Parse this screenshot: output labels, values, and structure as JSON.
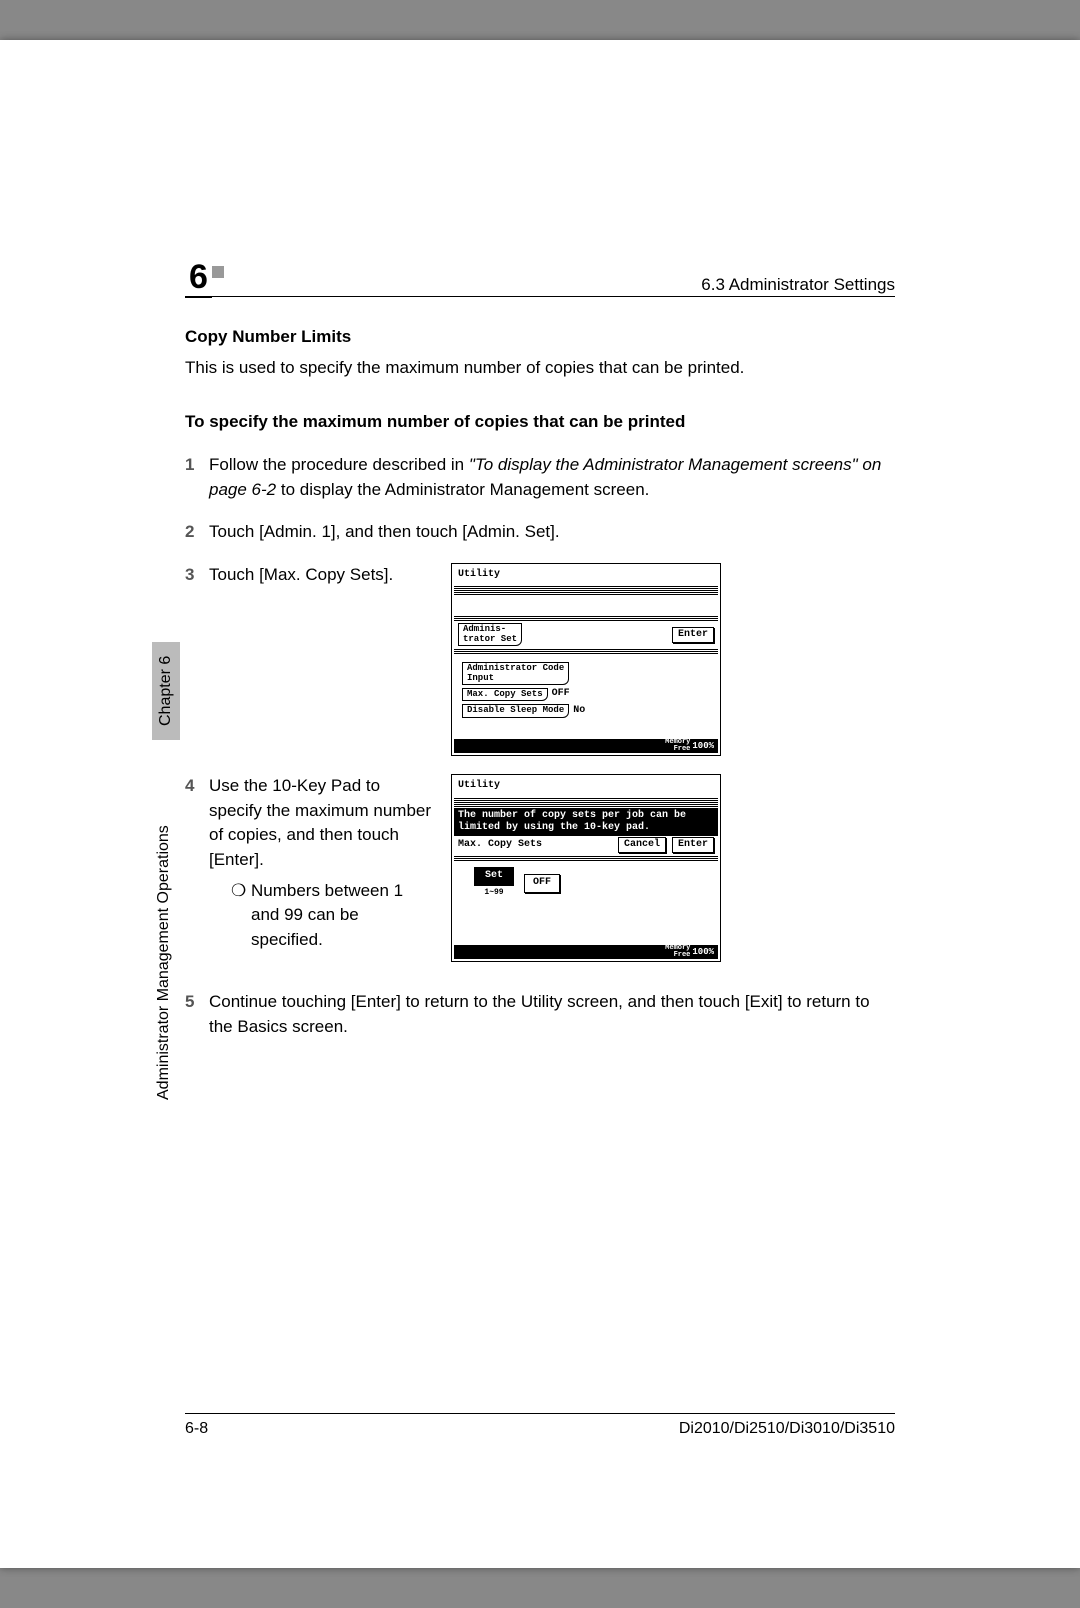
{
  "chapter_number": "6",
  "section_header": "6.3 Administrator Settings",
  "heading": "Copy Number Limits",
  "intro": "This is used to specify the maximum number of copies that can be printed.",
  "subheading": "To specify the maximum number of copies that can be printed",
  "steps": {
    "s1": {
      "num": "1",
      "text_a": "Follow the procedure described in ",
      "text_ref": "\"To display the Administrator Management screens\" on page 6-2",
      "text_b": " to display the Administrator Management screen."
    },
    "s2": {
      "num": "2",
      "text": "Touch [Admin. 1], and then touch [Admin. Set]."
    },
    "s3": {
      "num": "3",
      "text": "Touch [Max. Copy Sets]."
    },
    "s4": {
      "num": "4",
      "text": "Use the 10-Key Pad to specify the maximum number of copies, and then touch [Enter].",
      "bullet_mark": "❍",
      "bullet": "Numbers between 1 and 99 can be specified."
    },
    "s5": {
      "num": "5",
      "text": "Continue touching [Enter] to return to the Utility screen, and then touch [Exit] to return to the Basics screen."
    }
  },
  "lcd1": {
    "title": "Utility",
    "tab": "Adminis-\ntrator Set",
    "enter": "Enter",
    "row1": "Administrator Code\nInput",
    "row2_label": "Max. Copy Sets",
    "row2_val": "OFF",
    "row3_label": "Disable Sleep Mode",
    "row3_val": "No",
    "mem_label": "Memory\nFree",
    "mem_val": "100%"
  },
  "lcd2": {
    "title": "Utility",
    "msg": "The number of copy sets per job can be limited by using the 10-key pad.",
    "row_label": "Max. Copy Sets",
    "cancel": "Cancel",
    "enter": "Enter",
    "set": "Set",
    "set_sub": "1~99",
    "off": "OFF",
    "mem_label": "Memory\nFree",
    "mem_val": "100%"
  },
  "side": {
    "chapter_label": "Chapter 6",
    "chapter_title": "Administrator Management Operations"
  },
  "footer": {
    "page": "6-8",
    "model": "Di2010/Di2510/Di3010/Di3510"
  }
}
